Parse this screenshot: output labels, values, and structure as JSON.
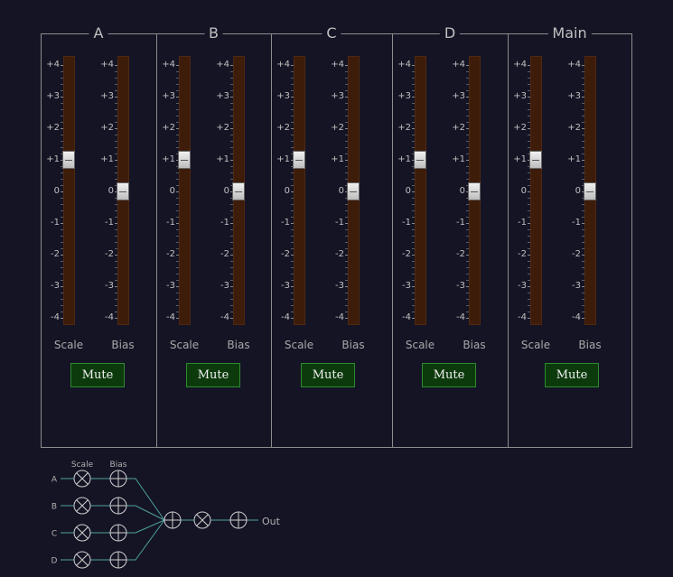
{
  "tick_labels": [
    "+4",
    "+3",
    "+2",
    "+1",
    "0",
    "-1",
    "-2",
    "-3",
    "-4"
  ],
  "fader_labels": {
    "scale": "Scale",
    "bias": "Bias"
  },
  "mute_label": "Mute",
  "channels": [
    {
      "name": "A",
      "scale": 1,
      "bias": 0
    },
    {
      "name": "B",
      "scale": 1,
      "bias": 0
    },
    {
      "name": "C",
      "scale": 1,
      "bias": 0
    },
    {
      "name": "D",
      "scale": 1,
      "bias": 0
    },
    {
      "name": "Main",
      "scale": 1,
      "bias": 0
    }
  ],
  "diagram": {
    "col_headers": {
      "scale": "Scale",
      "bias": "Bias"
    },
    "inputs": [
      "A",
      "B",
      "C",
      "D"
    ],
    "output": "Out"
  },
  "colors": {
    "background": "#141425",
    "track": "#3d1c0a",
    "mute_bg": "#0c3a0c",
    "mute_border": "#2f8a2f",
    "wire": "#4fa29a"
  }
}
